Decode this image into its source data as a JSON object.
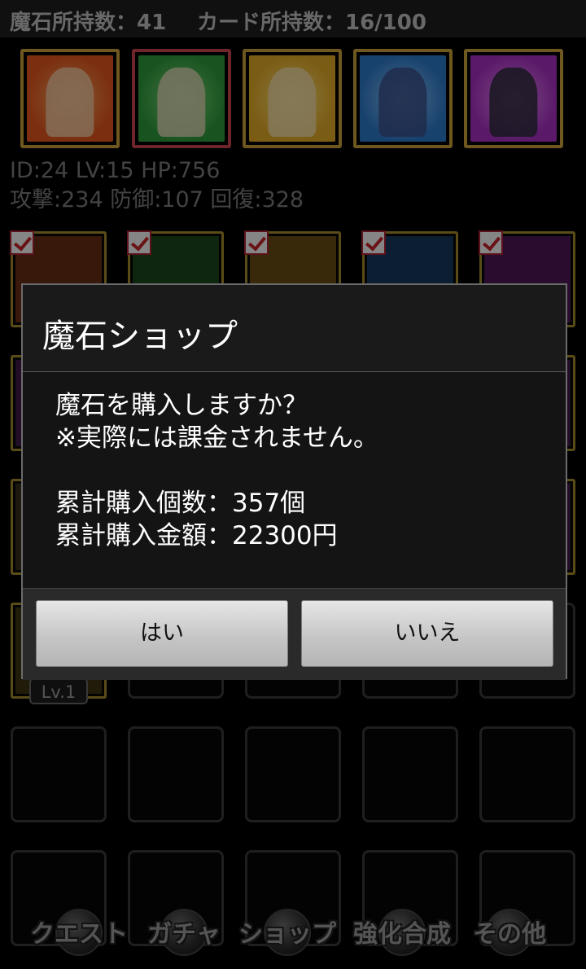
{
  "topbar": {
    "stones": "魔石所持数：41",
    "cards": "カード所持数：16/100"
  },
  "party": [
    {
      "name": "party-card-1",
      "bg": "#e0561e",
      "face": "#f2c7a0",
      "frame": "#c9a13a",
      "selected": false
    },
    {
      "name": "party-card-2",
      "bg": "#2f9a3b",
      "face": "#d9d6b0",
      "frame": "#c8464f",
      "selected": true
    },
    {
      "name": "party-card-3",
      "bg": "#e0a825",
      "face": "#f1dca5",
      "frame": "#c9a13a",
      "selected": false
    },
    {
      "name": "party-card-4",
      "bg": "#2d78c8",
      "face": "#3a4f8a",
      "frame": "#c9a13a",
      "selected": false
    },
    {
      "name": "party-card-5",
      "bg": "#a52fc0",
      "face": "#2a2a3a",
      "frame": "#c9a13a",
      "selected": false
    }
  ],
  "stats": {
    "line1": "ID:24 LV:15 HP:756",
    "line2": "攻撃:234 防御:107 回復:328"
  },
  "grid_level_badge": "Lv.1",
  "dialog": {
    "title": "魔石ショップ",
    "line1": "魔石を購入しますか？",
    "line2": "※実際には課金されません。",
    "line3": "累計購入個数：357個",
    "line4": "累計購入金額：22300円",
    "yes": "はい",
    "no": "いいえ"
  },
  "tabs": [
    "クエスト",
    "ガチャ",
    "ショップ",
    "強化合成",
    "その他"
  ]
}
